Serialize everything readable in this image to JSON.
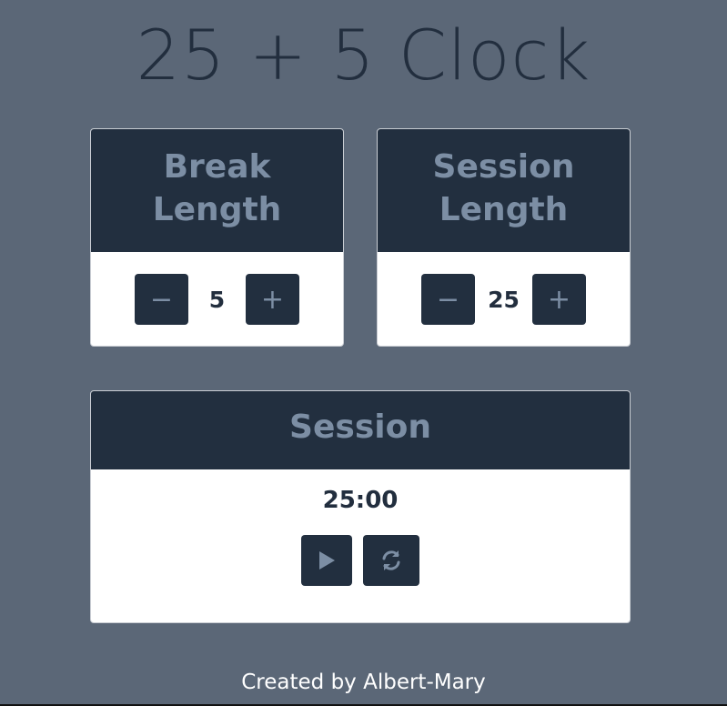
{
  "app": {
    "title": "25 + 5 Clock"
  },
  "break": {
    "label_line1": "Break",
    "label_line2": "Length",
    "decrement_glyph": "−",
    "increment_glyph": "+",
    "value": "5"
  },
  "session": {
    "label_line1": "Session",
    "label_line2": "Length",
    "decrement_glyph": "−",
    "increment_glyph": "+",
    "value": "25"
  },
  "timer": {
    "label": "Session",
    "time": "25:00",
    "icons": {
      "start": "play-icon",
      "reset": "refresh-icon"
    }
  },
  "footer": {
    "text": "Created by Albert-Mary"
  },
  "colors": {
    "background": "#5b6777",
    "card_header": "#222f3f",
    "header_text": "#7c8ea4",
    "title_text": "#222e3e"
  }
}
